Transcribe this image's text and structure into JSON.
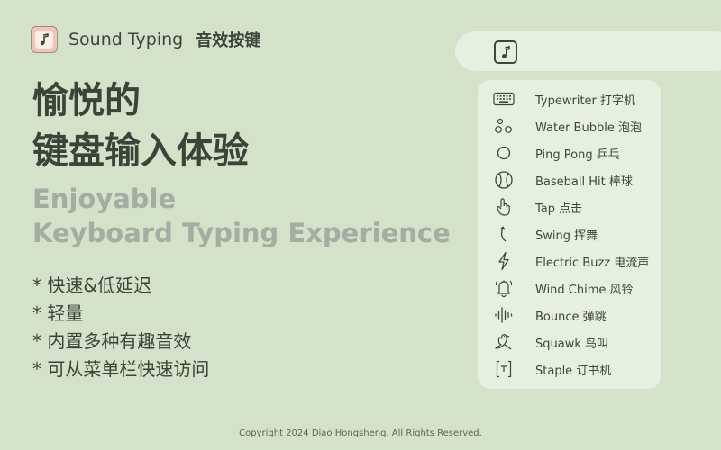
{
  "app": {
    "name": "Sound Typing",
    "name_cn": "音效按键"
  },
  "headline": {
    "cn_line1": "愉悦的",
    "cn_line2": "键盘输入体验",
    "en_line1": "Enjoyable",
    "en_line2": "Keyboard Typing Experience"
  },
  "features": [
    "* 快速&低延迟",
    "* 轻量",
    "* 内置多种有趣音效",
    "* 可从菜单栏快速访问"
  ],
  "menu": {
    "items": [
      {
        "label": "Typewriter 打字机",
        "icon": "keyboard-icon"
      },
      {
        "label": "Water Bubble 泡泡",
        "icon": "bubbles-icon"
      },
      {
        "label": "Ping Pong 乒乓",
        "icon": "circle-icon"
      },
      {
        "label": "Baseball Hit 棒球",
        "icon": "baseball-icon"
      },
      {
        "label": "Tap 点击",
        "icon": "tap-hand-icon"
      },
      {
        "label": "Swing 挥舞",
        "icon": "swing-arrow-icon"
      },
      {
        "label": "Electric Buzz 电流声",
        "icon": "lightning-icon"
      },
      {
        "label": "Wind Chime 风铃",
        "icon": "bell-icon"
      },
      {
        "label": "Bounce 弹跳",
        "icon": "waveform-icon"
      },
      {
        "label": "Squawk 鸟叫",
        "icon": "bird-icon"
      },
      {
        "label": "Staple 订书机",
        "icon": "staple-icon"
      }
    ]
  },
  "footer": {
    "copyright": "Copyright 2024 Diao Hongsheng. All Rights Reserved."
  },
  "colors": {
    "background": "#d3e2c9",
    "panel": "#e7efe1",
    "accent": "#f1c6b8",
    "text": "#3e463c",
    "muted": "#a6aca1"
  }
}
